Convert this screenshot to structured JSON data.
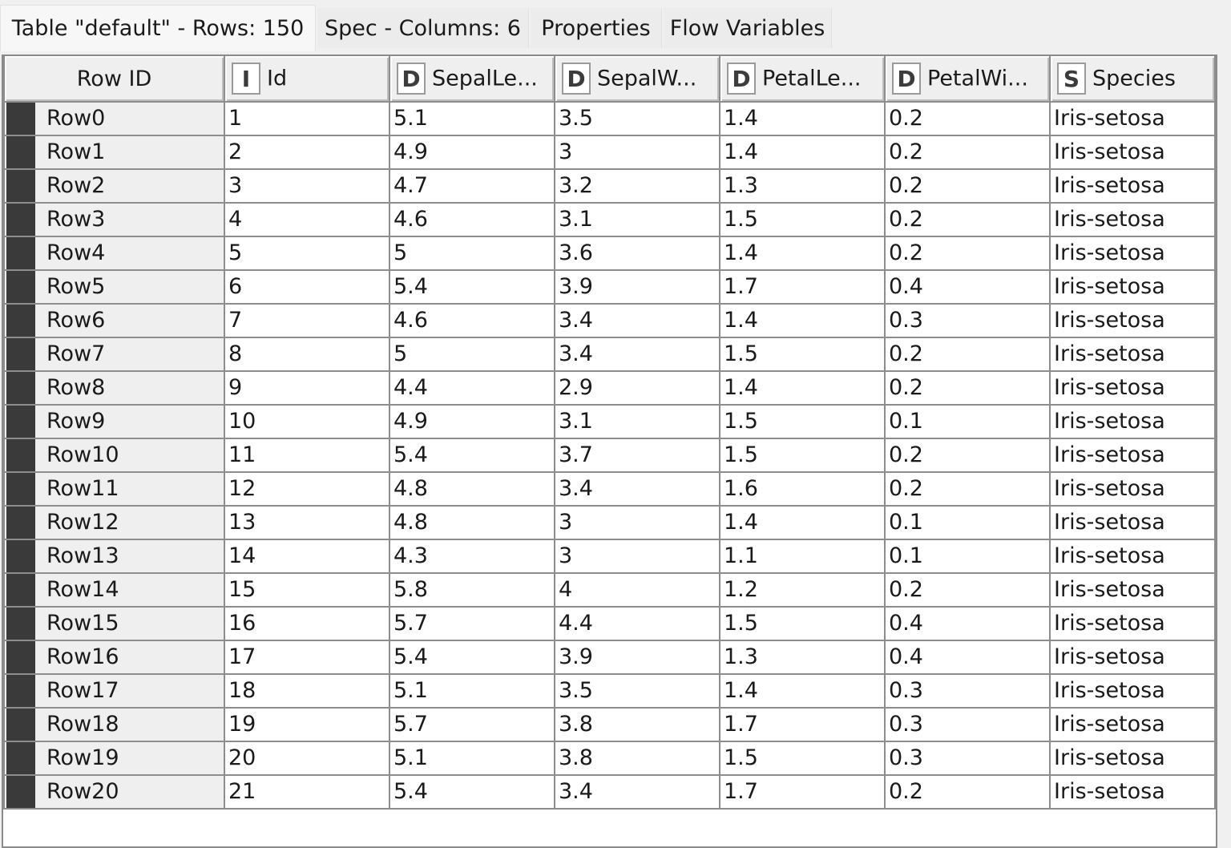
{
  "tabs": [
    {
      "label": "Table \"default\" - Rows: 150",
      "active": true
    },
    {
      "label": "Spec - Columns: 6",
      "active": false
    },
    {
      "label": "Properties",
      "active": false
    },
    {
      "label": "Flow Variables",
      "active": false
    }
  ],
  "table": {
    "row_id_header": "Row ID",
    "columns": [
      {
        "type": "I",
        "type_icon": "integer-type-icon",
        "label": "Id"
      },
      {
        "type": "D",
        "type_icon": "double-type-icon",
        "label": "SepalLe..."
      },
      {
        "type": "D",
        "type_icon": "double-type-icon",
        "label": "SepalW..."
      },
      {
        "type": "D",
        "type_icon": "double-type-icon",
        "label": "PetalLe..."
      },
      {
        "type": "D",
        "type_icon": "double-type-icon",
        "label": "PetalWi..."
      },
      {
        "type": "S",
        "type_icon": "string-type-icon",
        "label": "Species"
      }
    ],
    "row_color_marker": "#3a3a3a",
    "rows": [
      {
        "id": "Row0",
        "cells": [
          "1",
          "5.1",
          "3.5",
          "1.4",
          "0.2",
          "Iris-setosa"
        ]
      },
      {
        "id": "Row1",
        "cells": [
          "2",
          "4.9",
          "3",
          "1.4",
          "0.2",
          "Iris-setosa"
        ]
      },
      {
        "id": "Row2",
        "cells": [
          "3",
          "4.7",
          "3.2",
          "1.3",
          "0.2",
          "Iris-setosa"
        ]
      },
      {
        "id": "Row3",
        "cells": [
          "4",
          "4.6",
          "3.1",
          "1.5",
          "0.2",
          "Iris-setosa"
        ]
      },
      {
        "id": "Row4",
        "cells": [
          "5",
          "5",
          "3.6",
          "1.4",
          "0.2",
          "Iris-setosa"
        ]
      },
      {
        "id": "Row5",
        "cells": [
          "6",
          "5.4",
          "3.9",
          "1.7",
          "0.4",
          "Iris-setosa"
        ]
      },
      {
        "id": "Row6",
        "cells": [
          "7",
          "4.6",
          "3.4",
          "1.4",
          "0.3",
          "Iris-setosa"
        ]
      },
      {
        "id": "Row7",
        "cells": [
          "8",
          "5",
          "3.4",
          "1.5",
          "0.2",
          "Iris-setosa"
        ]
      },
      {
        "id": "Row8",
        "cells": [
          "9",
          "4.4",
          "2.9",
          "1.4",
          "0.2",
          "Iris-setosa"
        ]
      },
      {
        "id": "Row9",
        "cells": [
          "10",
          "4.9",
          "3.1",
          "1.5",
          "0.1",
          "Iris-setosa"
        ]
      },
      {
        "id": "Row10",
        "cells": [
          "11",
          "5.4",
          "3.7",
          "1.5",
          "0.2",
          "Iris-setosa"
        ]
      },
      {
        "id": "Row11",
        "cells": [
          "12",
          "4.8",
          "3.4",
          "1.6",
          "0.2",
          "Iris-setosa"
        ]
      },
      {
        "id": "Row12",
        "cells": [
          "13",
          "4.8",
          "3",
          "1.4",
          "0.1",
          "Iris-setosa"
        ]
      },
      {
        "id": "Row13",
        "cells": [
          "14",
          "4.3",
          "3",
          "1.1",
          "0.1",
          "Iris-setosa"
        ]
      },
      {
        "id": "Row14",
        "cells": [
          "15",
          "5.8",
          "4",
          "1.2",
          "0.2",
          "Iris-setosa"
        ]
      },
      {
        "id": "Row15",
        "cells": [
          "16",
          "5.7",
          "4.4",
          "1.5",
          "0.4",
          "Iris-setosa"
        ]
      },
      {
        "id": "Row16",
        "cells": [
          "17",
          "5.4",
          "3.9",
          "1.3",
          "0.4",
          "Iris-setosa"
        ]
      },
      {
        "id": "Row17",
        "cells": [
          "18",
          "5.1",
          "3.5",
          "1.4",
          "0.3",
          "Iris-setosa"
        ]
      },
      {
        "id": "Row18",
        "cells": [
          "19",
          "5.7",
          "3.8",
          "1.7",
          "0.3",
          "Iris-setosa"
        ]
      },
      {
        "id": "Row19",
        "cells": [
          "20",
          "5.1",
          "3.8",
          "1.5",
          "0.3",
          "Iris-setosa"
        ]
      },
      {
        "id": "Row20",
        "cells": [
          "21",
          "5.4",
          "3.4",
          "1.7",
          "0.2",
          "Iris-setosa"
        ]
      }
    ]
  }
}
